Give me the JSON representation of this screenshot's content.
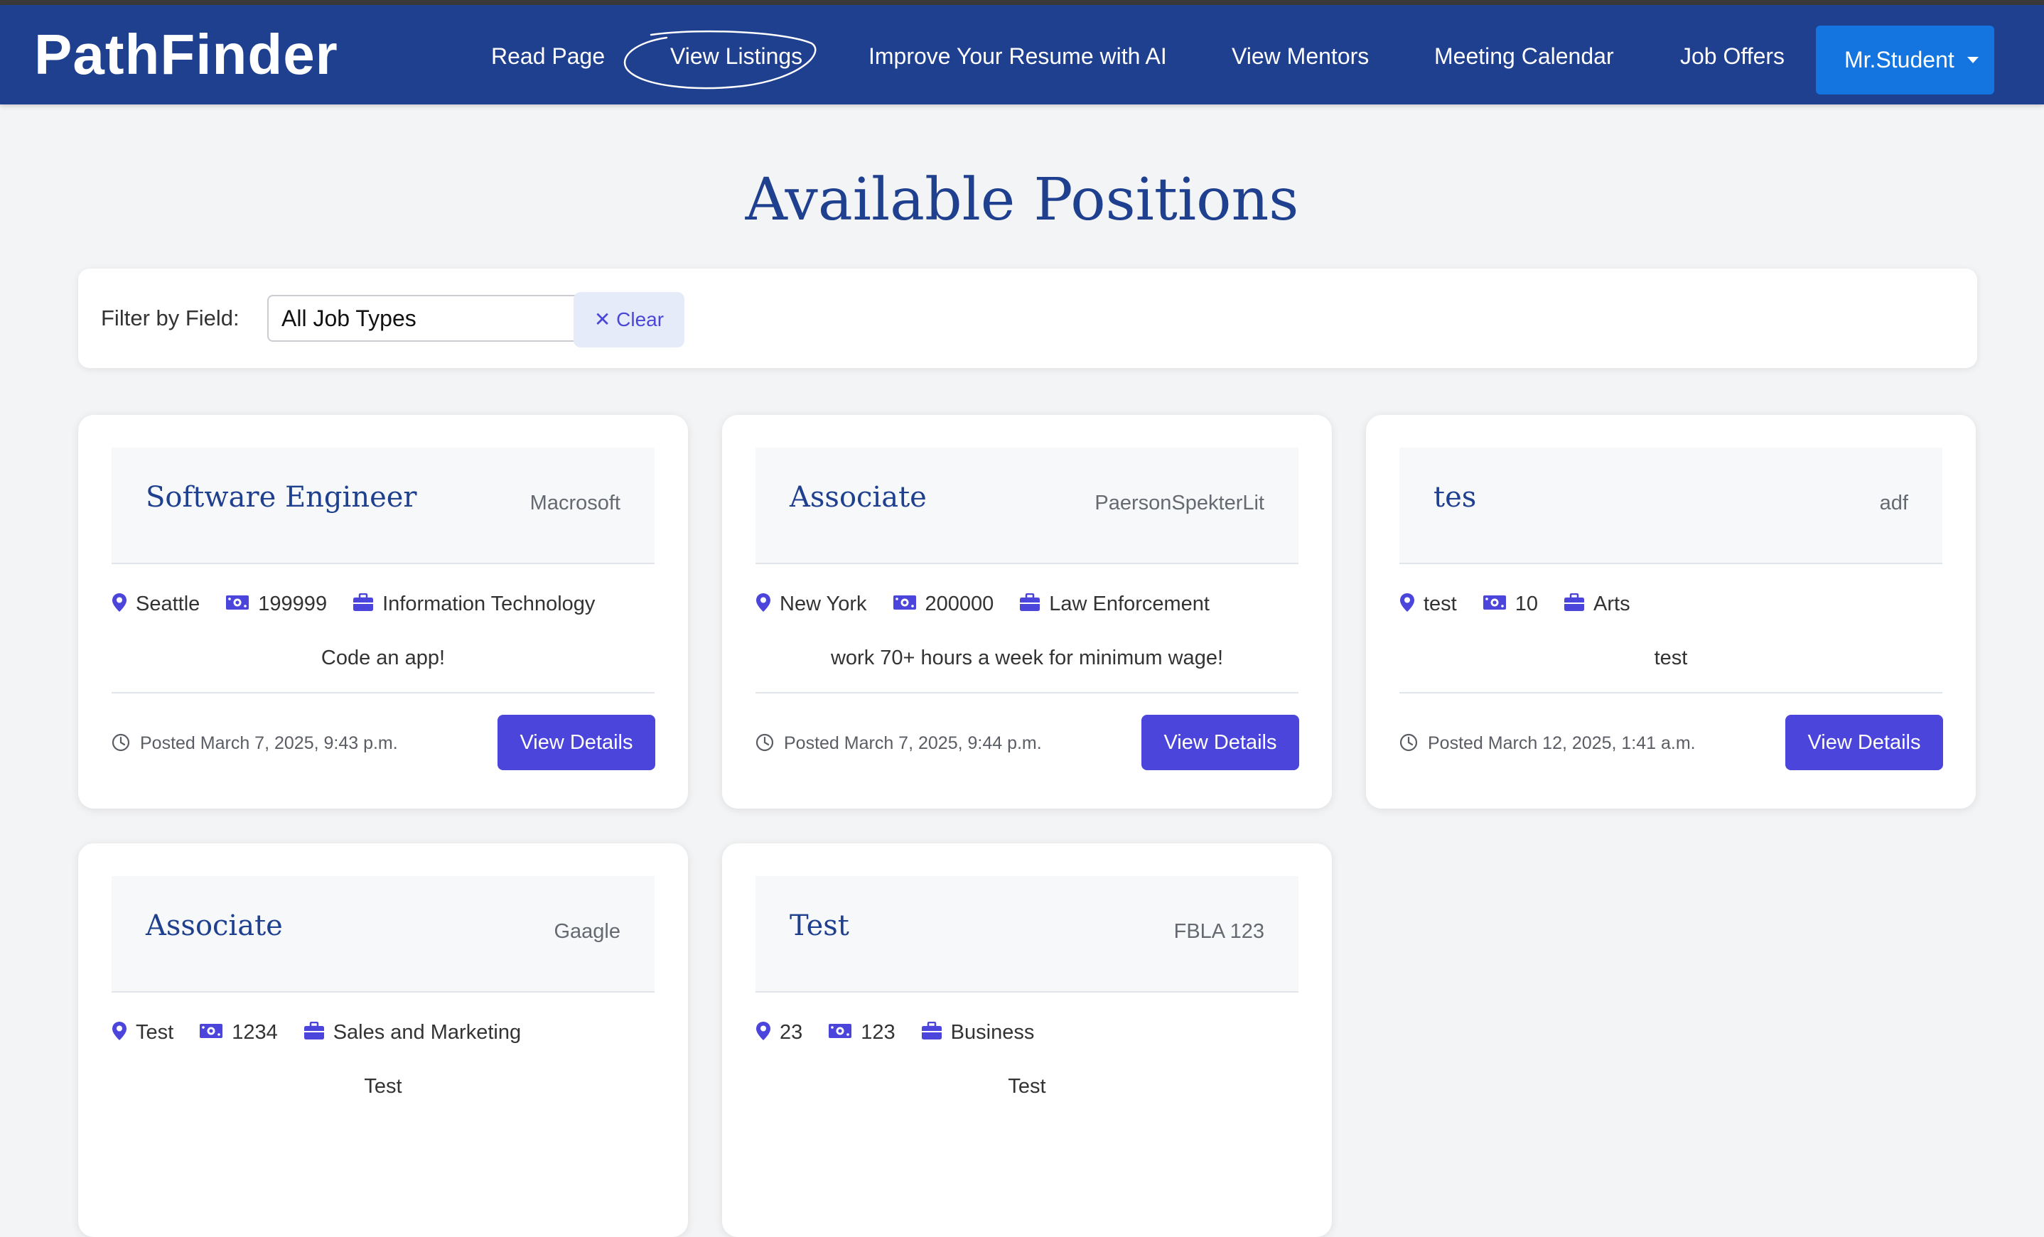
{
  "nav": {
    "brand": "PathFinder",
    "links": [
      {
        "label": "Read Page"
      },
      {
        "label": "View Listings"
      },
      {
        "label": "Improve Your Resume with AI"
      },
      {
        "label": "View Mentors"
      },
      {
        "label": "Meeting Calendar"
      },
      {
        "label": "Job Offers"
      }
    ],
    "user_button": "Mr.Student"
  },
  "page": {
    "title": "Available Positions"
  },
  "filter": {
    "label": "Filter by Field:",
    "selected": "All Job Types",
    "clear_label": "✕ Clear"
  },
  "colors": {
    "navbar": "#1f3f8f",
    "accent": "#4b45dc",
    "user_button": "#1474e0",
    "title": "#1f3f8f"
  },
  "jobs": [
    {
      "title": "Software Engineer",
      "company": "Macrosoft",
      "location": "Seattle",
      "salary": "199999",
      "field": "Information Technology",
      "description": "Code an app!",
      "posted": "Posted March 7, 2025, 9:43 p.m.",
      "button": "View Details"
    },
    {
      "title": "Associate",
      "company": "PaersonSpekterLit",
      "location": "New York",
      "salary": "200000",
      "field": "Law Enforcement",
      "description": "work 70+ hours a week for minimum wage!",
      "posted": "Posted March 7, 2025, 9:44 p.m.",
      "button": "View Details"
    },
    {
      "title": "tes",
      "company": "adf",
      "location": "test",
      "salary": "10",
      "field": "Arts",
      "description": "test",
      "posted": "Posted March 12, 2025, 1:41 a.m.",
      "button": "View Details"
    },
    {
      "title": "Associate",
      "company": "Gaagle",
      "location": "Test",
      "salary": "1234",
      "field": "Sales and Marketing",
      "description": "Test",
      "posted": "",
      "button": ""
    },
    {
      "title": "Test",
      "company": "FBLA 123",
      "location": "23",
      "salary": "123",
      "field": "Business",
      "description": "Test",
      "posted": "",
      "button": ""
    }
  ]
}
